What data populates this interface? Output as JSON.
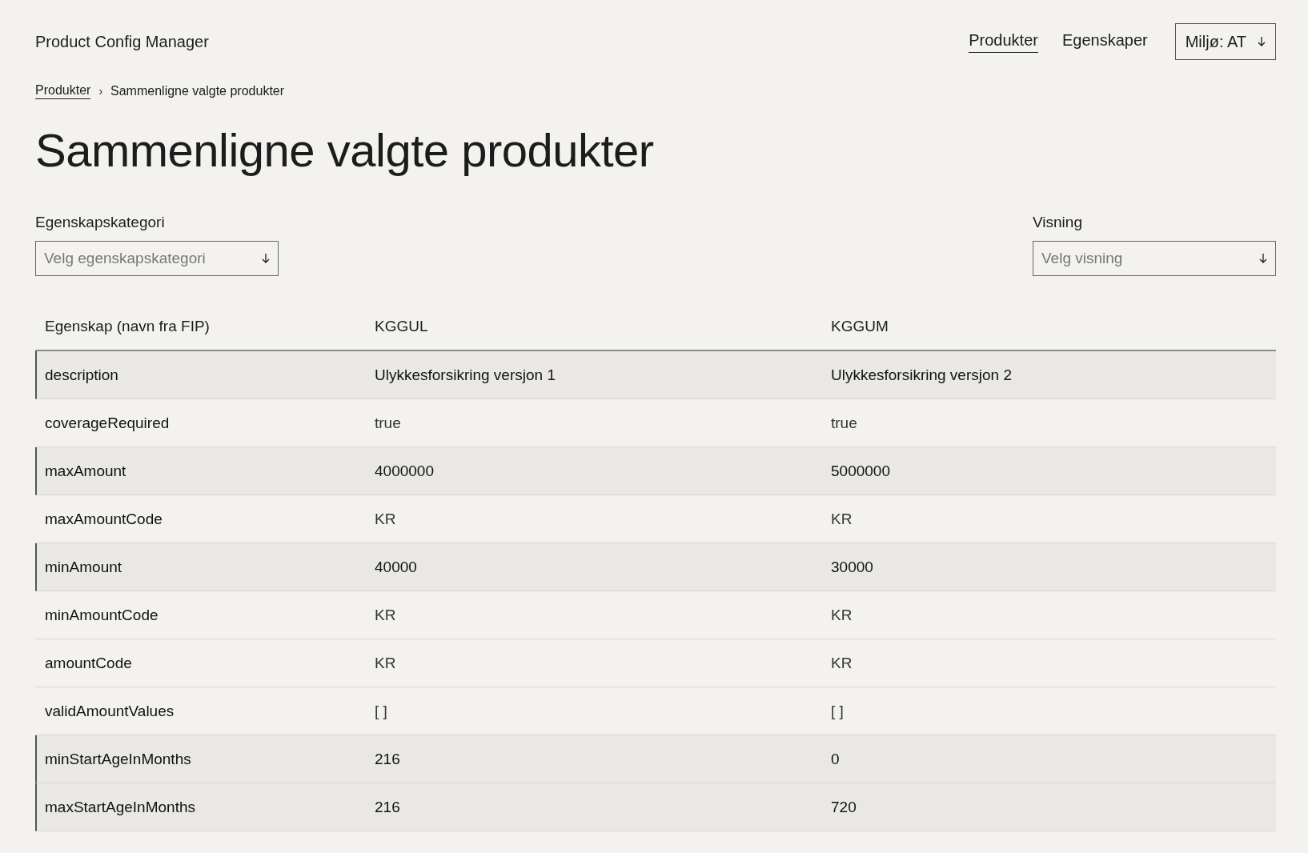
{
  "app_title": "Product Config Manager",
  "nav": [
    {
      "label": "Produkter",
      "selected": true
    },
    {
      "label": "Egenskaper",
      "selected": false
    }
  ],
  "environment_button": "Miljø: AT",
  "breadcrumb": [
    {
      "label": "Produkter",
      "kind": "link"
    },
    {
      "label": "›",
      "kind": "separator"
    },
    {
      "label": "Sammenligne valgte produkter",
      "kind": "current"
    }
  ],
  "page_title": "Sammenligne valgte produkter",
  "filters": [
    {
      "label": "Egenskapskategori",
      "placeholder": "Velg egenskapskategori"
    },
    {
      "label": "Visning",
      "placeholder": "Velg visning"
    }
  ],
  "table": {
    "columns": [
      "Egenskap (navn fra FIP)",
      "KGGUL",
      "KGGUM"
    ],
    "rows": [
      {
        "cells": [
          "description",
          "Ulykkesforsikring versjon 1",
          "Ulykkesforsikring versjon 2"
        ],
        "differs": true
      },
      {
        "cells": [
          "coverageRequired",
          "true",
          "true"
        ],
        "differs": false
      },
      {
        "cells": [
          "maxAmount",
          "4000000",
          "5000000"
        ],
        "differs": true
      },
      {
        "cells": [
          "maxAmountCode",
          "KR",
          "KR"
        ],
        "differs": false
      },
      {
        "cells": [
          "minAmount",
          "40000",
          "30000"
        ],
        "differs": true
      },
      {
        "cells": [
          "minAmountCode",
          "KR",
          "KR"
        ],
        "differs": false
      },
      {
        "cells": [
          "amountCode",
          "KR",
          "KR"
        ],
        "differs": false
      },
      {
        "cells": [
          "validAmountValues",
          "[ ]",
          "[ ]"
        ],
        "differs": false
      },
      {
        "cells": [
          "minStartAgeInMonths",
          "216",
          "0"
        ],
        "differs": true
      },
      {
        "cells": [
          "maxStartAgeInMonths",
          "216",
          "720"
        ],
        "differs": true
      }
    ]
  }
}
